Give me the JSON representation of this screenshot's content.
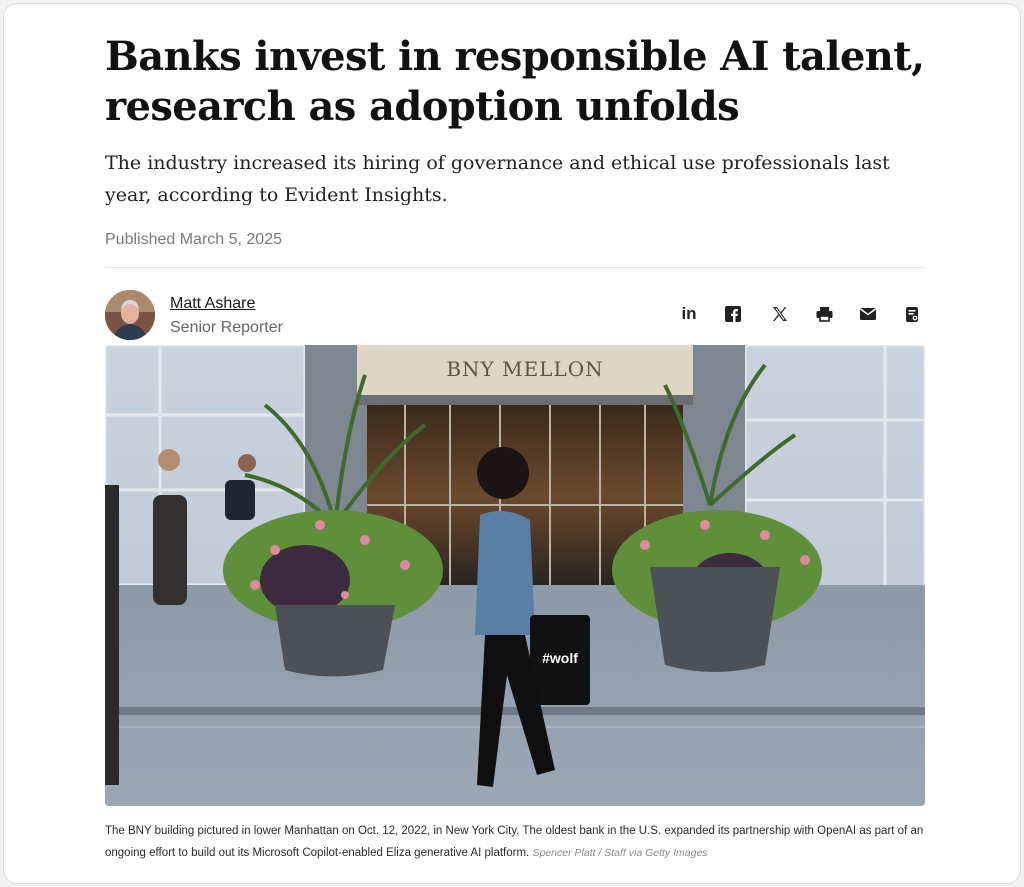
{
  "article": {
    "headline": "Banks invest in responsible AI talent, research as adoption unfolds",
    "dek": "The industry increased its hiring of governance and ethical use professionals last year, according to Evident Insights.",
    "published": "Published March 5, 2025"
  },
  "author": {
    "name": "Matt Ashare",
    "role": "Senior Reporter"
  },
  "share": {
    "icons": [
      "linkedin-icon",
      "facebook-icon",
      "x-icon",
      "print-icon",
      "email-icon",
      "clipboard-icon"
    ],
    "linkedin_text": "in"
  },
  "photo": {
    "sign_text": "BNY MELLON",
    "bag_text": "#wolf"
  },
  "caption": {
    "text": "The BNY building pictured in lower Manhattan on Oct. 12, 2022, in New York City. The oldest bank in the U.S. expanded its partnership with OpenAI as part of an ongoing effort to build out its Microsoft Copilot-enabled Eliza generative AI platform.",
    "credit": "Spencer Platt / Staff via Getty Images"
  },
  "colors": {
    "text": "#1a1a1a",
    "muted": "#7a7a7a",
    "card_border": "#dcdce0"
  }
}
